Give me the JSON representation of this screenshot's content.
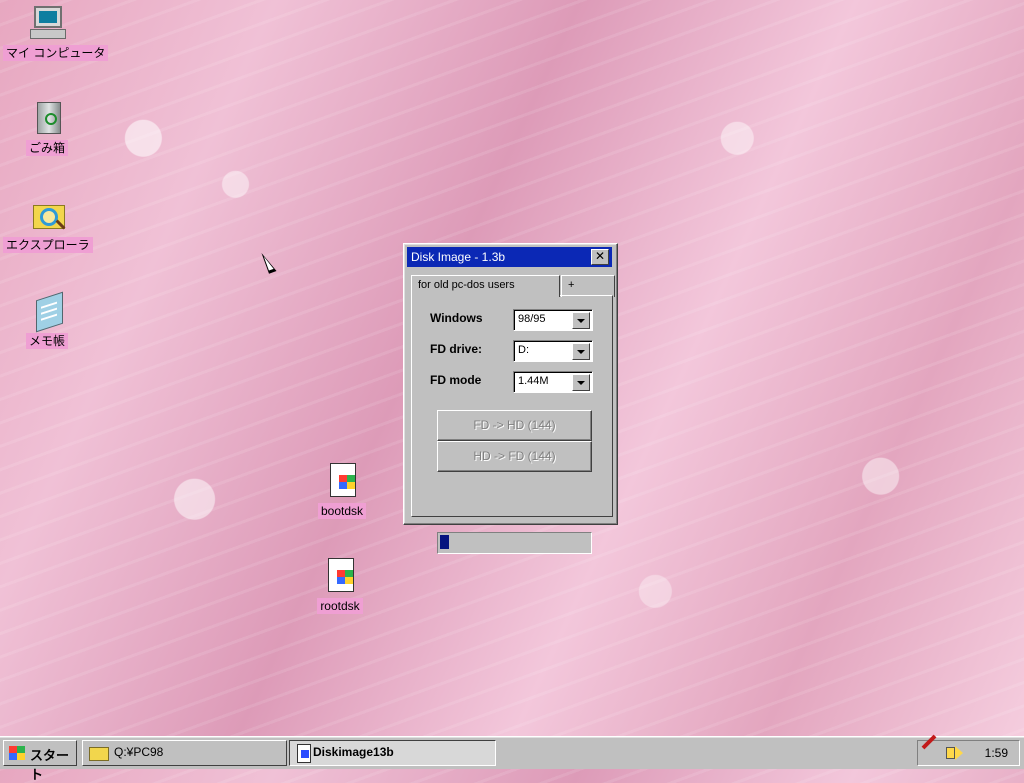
{
  "desktop": {
    "icons": {
      "my_computer": "マイ コンピュータ",
      "recycle_bin": "ごみ箱",
      "explorer": "エクスプローラ",
      "notepad": "メモ帳",
      "bootdsk": "bootdsk",
      "rootdsk": "rootdsk"
    },
    "label_color": "#ef9fd3"
  },
  "window": {
    "title": "Disk Image - 1.3b",
    "close_symbol": "✕",
    "tabs": [
      {
        "label": "for old pc-dos users"
      },
      {
        "label": "+"
      }
    ],
    "fields": {
      "windows": {
        "label": "Windows",
        "value": "98/95"
      },
      "drive": {
        "label": "FD drive:",
        "value": "D:"
      },
      "mode": {
        "label": "FD mode",
        "value": "1.44M"
      }
    },
    "buttons": {
      "fd_to_hd": "FD -> HD (144)",
      "hd_to_fd": "HD -> FD (144)"
    },
    "progress": 0.06,
    "title_color": "#0b28b5"
  },
  "taskbar": {
    "start_label": "スタート",
    "tasks": {
      "folder": "Q:¥PC98",
      "diskimage": "Diskimage13b"
    },
    "clock": "1:59"
  }
}
